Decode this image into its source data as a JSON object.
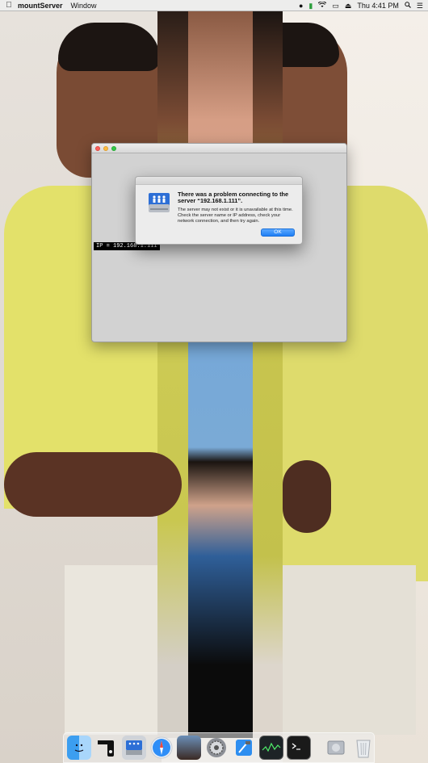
{
  "menubar": {
    "app_name": "mountServer",
    "menus": [
      "Window"
    ],
    "clock": "Thu 4:41 PM",
    "status_icons": [
      "creative-cloud-icon",
      "activity-icon",
      "wifi-icon",
      "airplay-icon",
      "eject-icon",
      "spotlight-icon",
      "notification-center-icon"
    ]
  },
  "window": {
    "ip_label": "IP = 192.168.1.111"
  },
  "alert": {
    "icon": "network-server-icon",
    "title": "There was a problem connecting to the server “192.168.1.111”.",
    "message": "The server may not exist or it is unavailable at this time. Check the server name or IP address, check your network connection, and then try again.",
    "ok_label": "OK",
    "accent_color": "#1f7ff5"
  },
  "dock": {
    "items": [
      "finder-icon",
      "usb-drive-icon",
      "network-server-icon",
      "safari-icon",
      "photo-icon",
      "system-preferences-icon",
      "xcode-icon",
      "activity-monitor-icon",
      "terminal-icon",
      "disk-utility-icon",
      "trash-icon"
    ]
  }
}
